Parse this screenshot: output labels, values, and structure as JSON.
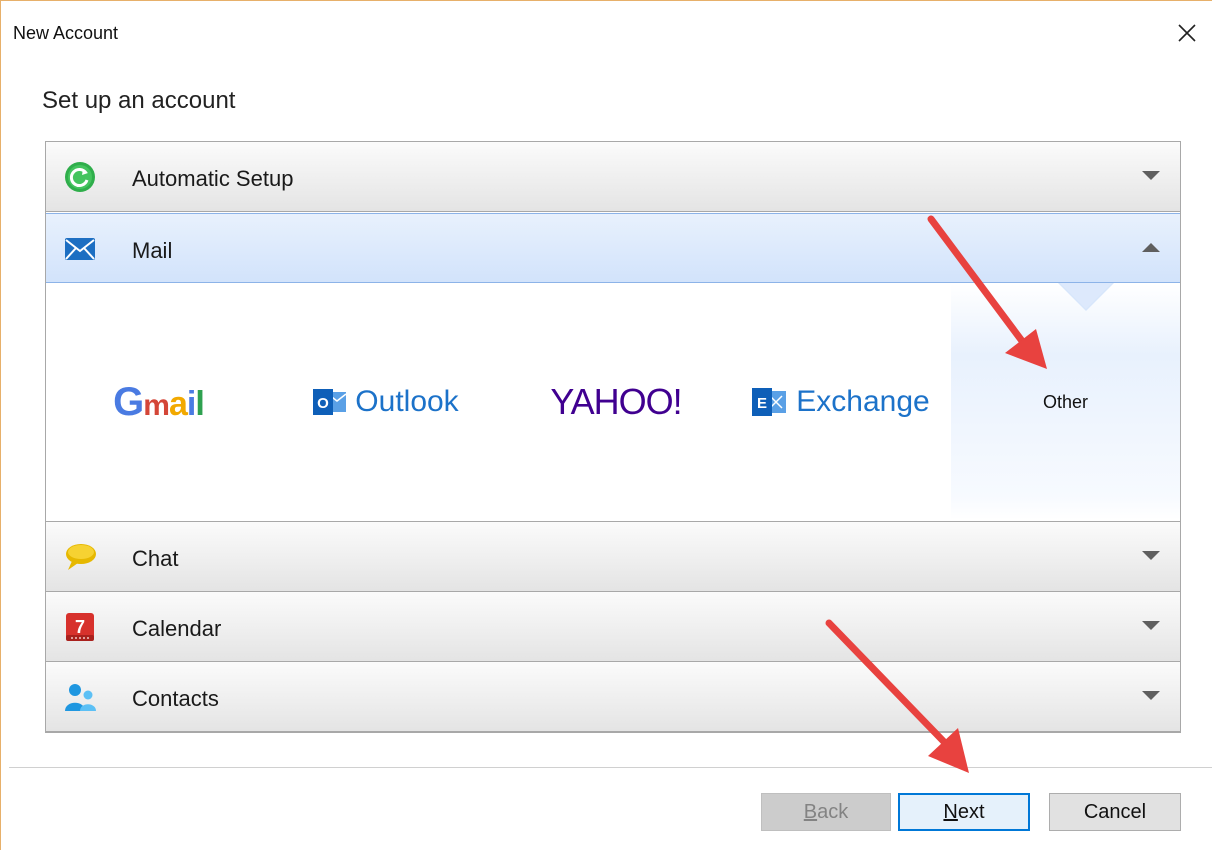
{
  "window": {
    "title": "New Account"
  },
  "heading": "Set up an account",
  "sections": [
    {
      "label": "Automatic Setup",
      "state": "collapsed",
      "icon": "refresh-circle-icon"
    },
    {
      "label": "Mail",
      "state": "expanded",
      "icon": "envelope-icon"
    },
    {
      "label": "Chat",
      "state": "collapsed",
      "icon": "speech-bubble-icon"
    },
    {
      "label": "Calendar",
      "state": "collapsed",
      "icon": "calendar-icon",
      "icon_text": "7"
    },
    {
      "label": "Contacts",
      "state": "collapsed",
      "icon": "people-icon"
    }
  ],
  "mail_providers": {
    "gmail": {
      "letters": [
        "G",
        "m",
        "a",
        "i",
        "l"
      ]
    },
    "outlook": {
      "text": "Outlook",
      "badge": "O"
    },
    "yahoo": {
      "text": "YAHOO!"
    },
    "exchange": {
      "text": "Exchange",
      "badge": "E"
    },
    "other": {
      "text": "Other",
      "selected": true
    }
  },
  "buttons": {
    "back": {
      "label": "Back",
      "mnemonic": "B",
      "rest": "ack",
      "enabled": false
    },
    "next": {
      "label": "Next",
      "mnemonic": "N",
      "rest": "ext",
      "enabled": true,
      "default": true
    },
    "cancel": {
      "label": "Cancel",
      "enabled": true
    }
  },
  "colors": {
    "accent": "#0078d7",
    "annotation_arrow": "#e8423f",
    "selected_section": "#d2e3fb"
  }
}
